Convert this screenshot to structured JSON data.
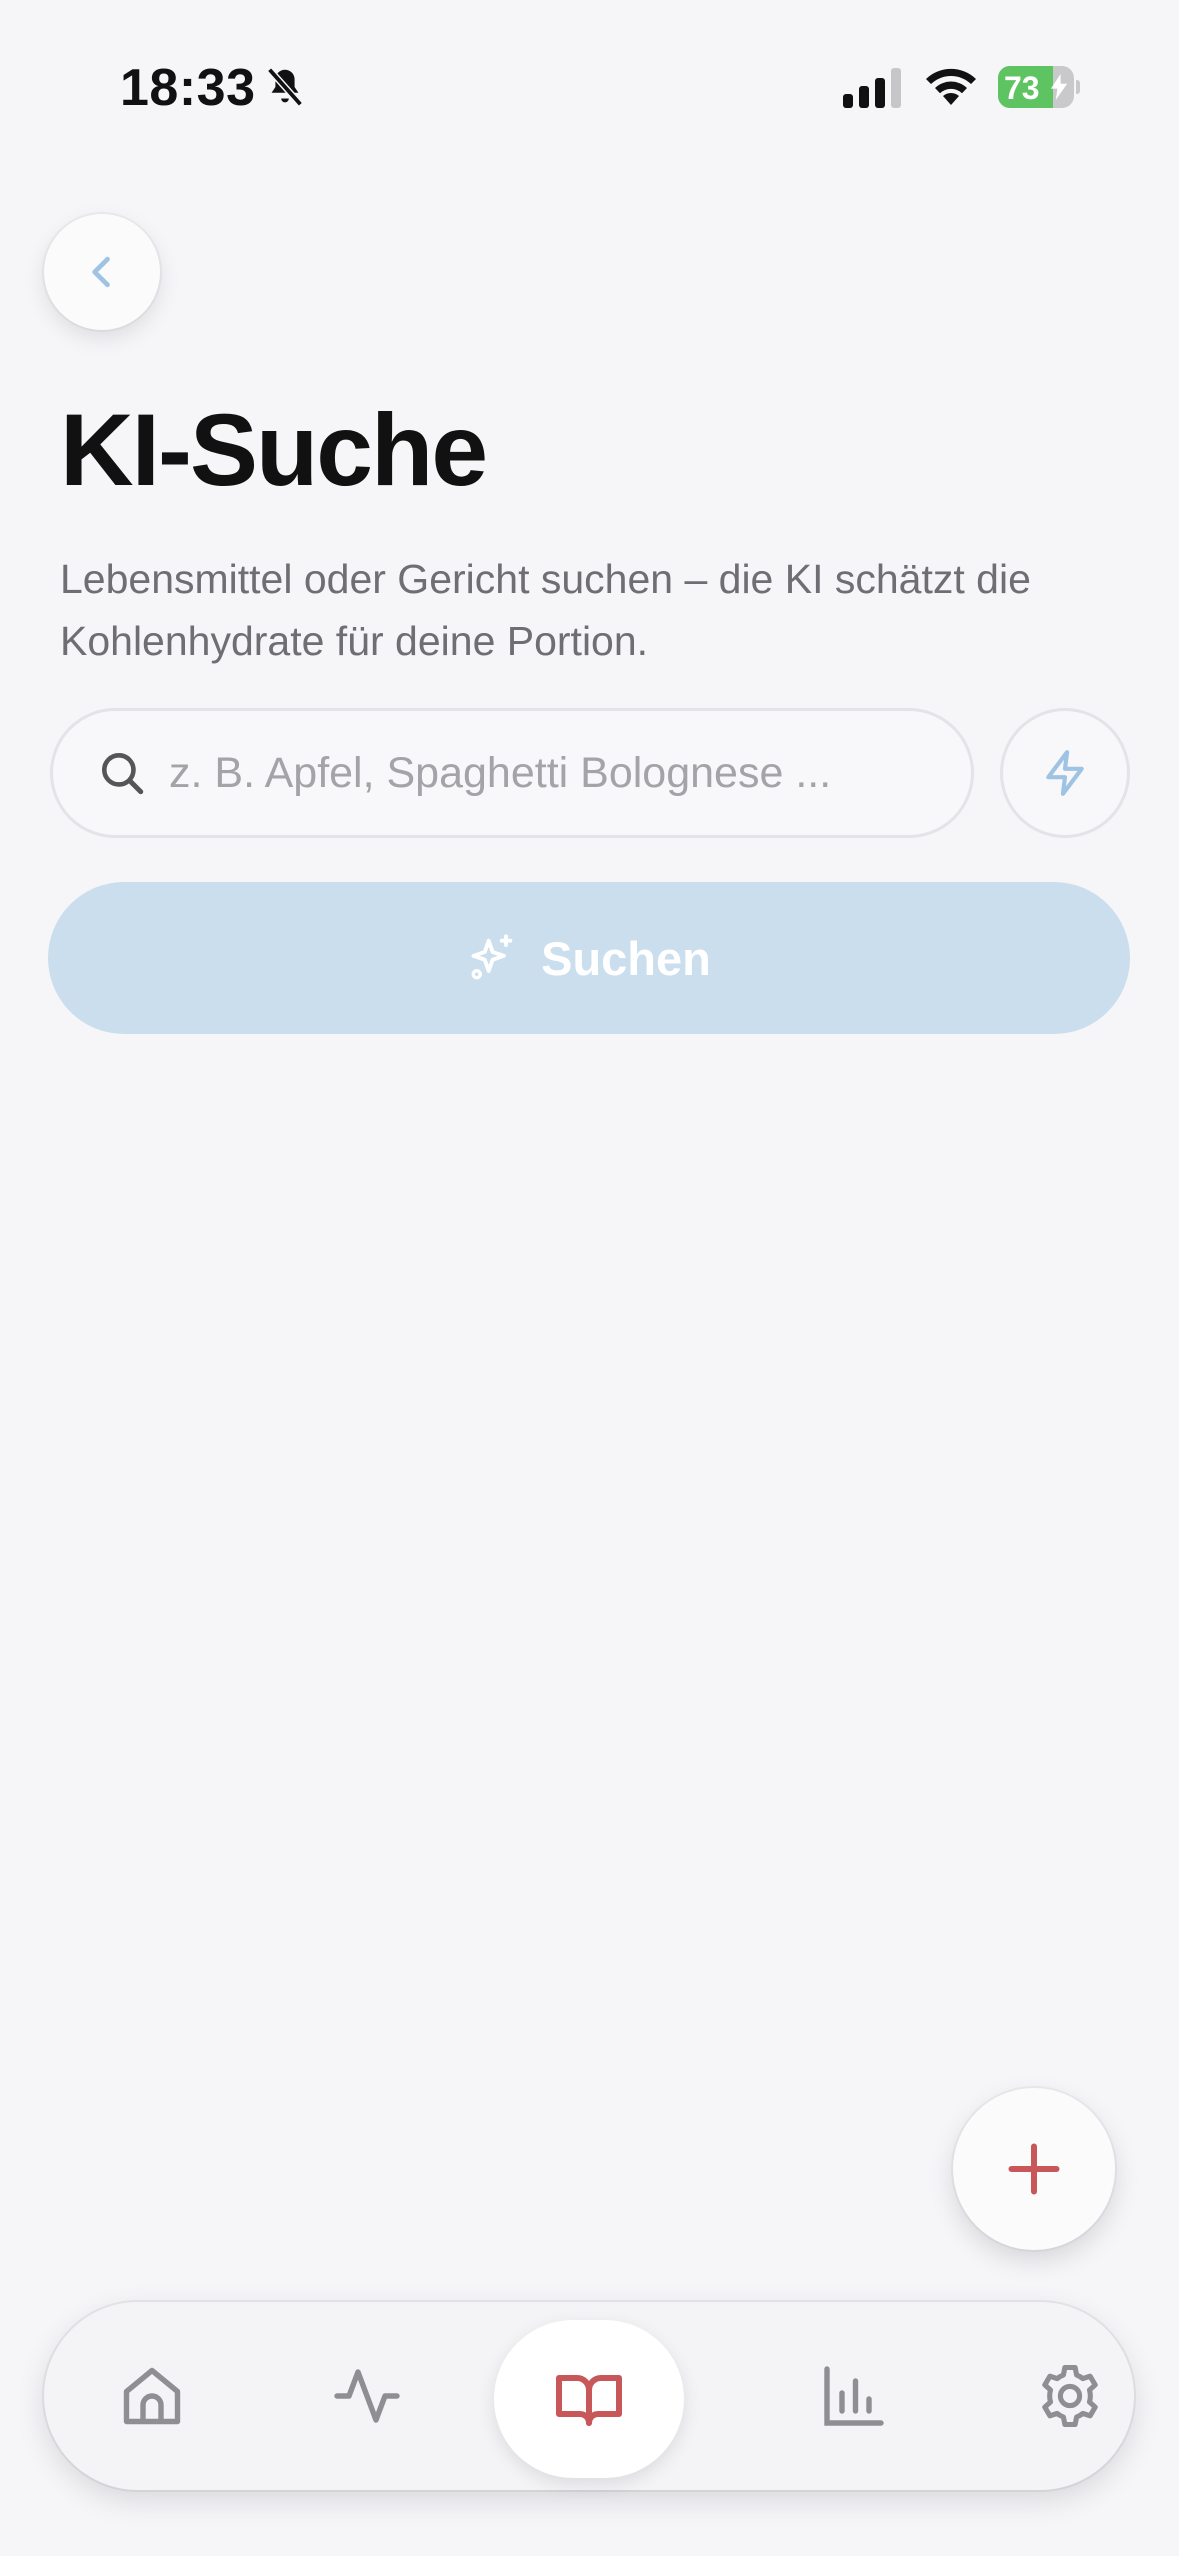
{
  "status_bar": {
    "time": "18:33",
    "battery_percent": "73",
    "battery_level": 0.73,
    "icons": [
      "bell-slash-icon",
      "cellular-signal-icon",
      "wifi-icon",
      "battery-charging-icon"
    ]
  },
  "header": {
    "back_icon": "chevron-left-icon",
    "title": "KI-Suche",
    "subtitle": "Lebensmittel oder Gericht suchen – die KI schätzt die Kohlenhydrate für deine Portion."
  },
  "search": {
    "value": "",
    "placeholder": "z. B. Apfel, Spaghetti Bolognese ...",
    "icon": "search-icon",
    "quick_icon": "lightning-bolt-icon",
    "button_label": "Suchen",
    "button_icon": "sparkles-icon"
  },
  "fab": {
    "icon": "plus-icon"
  },
  "tab_bar": {
    "items": [
      {
        "icon": "home-icon",
        "active": false
      },
      {
        "icon": "activity-pulse-icon",
        "active": false
      },
      {
        "icon": "book-open-icon",
        "active": true
      },
      {
        "icon": "bar-chart-icon",
        "active": false
      },
      {
        "icon": "gear-icon",
        "active": false
      }
    ]
  },
  "colors": {
    "background": "#f6f6f9",
    "accent_blue": "#9fc3e3",
    "search_button_bg": "#cbdeee",
    "active_red": "#c8575a",
    "battery_green": "#5dc461",
    "inactive_gray": "#8e8e93"
  }
}
